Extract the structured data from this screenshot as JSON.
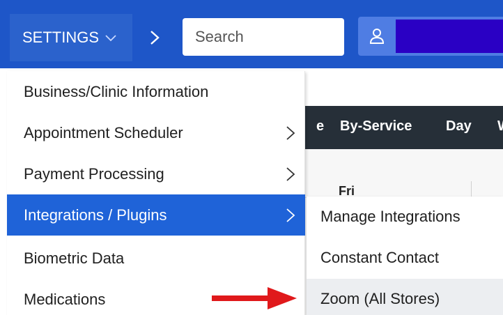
{
  "topbar": {
    "settings_label": "SETTINGS",
    "settings_icon": "chevron-down-icon",
    "next_icon": "chevron-right-icon",
    "search_placeholder": "Search",
    "user_icon": "user-icon"
  },
  "background": {
    "toolbar_items": [
      "e",
      "By-Service",
      "Day",
      "W"
    ],
    "day_header": "Fri"
  },
  "menu": {
    "items": [
      {
        "label": "Business/Clinic Information",
        "has_submenu": false
      },
      {
        "label": "Appointment Scheduler",
        "has_submenu": true
      },
      {
        "label": "Payment Processing",
        "has_submenu": true
      },
      {
        "label": "Integrations / Plugins",
        "has_submenu": true,
        "active": true
      },
      {
        "label": "Biometric Data",
        "has_submenu": false
      },
      {
        "label": "Medications",
        "has_submenu": false
      }
    ]
  },
  "submenu": {
    "items": [
      {
        "label": "Manage Integrations"
      },
      {
        "label": "Constant Contact"
      },
      {
        "label": "Zoom (All Stores)",
        "highlighted": true
      }
    ]
  },
  "colors": {
    "header_blue": "#1e56c8",
    "active_item": "#1f63d8",
    "annotation_red": "#e0191b"
  }
}
